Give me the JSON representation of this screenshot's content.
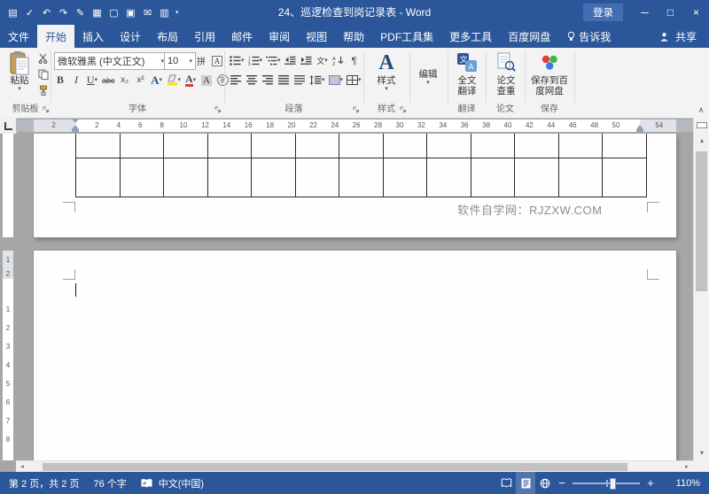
{
  "window": {
    "title": "24、巡逻检查到岗记录表 - Word",
    "login": "登录",
    "qat_icons": [
      "save",
      "spelling",
      "undo",
      "redo",
      "draw-table",
      "table",
      "new",
      "open",
      "email",
      "print"
    ],
    "controls": [
      "minimize",
      "maximize",
      "close"
    ]
  },
  "tabs": {
    "file": "文件",
    "active": "开始",
    "others": [
      "插入",
      "设计",
      "布局",
      "引用",
      "邮件",
      "审阅",
      "视图",
      "帮助",
      "PDF工具集",
      "更多工具",
      "百度网盘"
    ],
    "tell_me": "告诉我",
    "share": "共享"
  },
  "ribbon": {
    "clipboard": {
      "paste": "粘贴",
      "icons": [
        "cut",
        "copy",
        "format-painter"
      ],
      "label": "剪贴板"
    },
    "font": {
      "name": "微软雅黑 (中文正文)",
      "size": "10",
      "row1_icons": [
        "phonetic-guide",
        "character-border"
      ],
      "row2_icons": [
        "bold",
        "italic",
        "underline",
        "strikethrough",
        "subscript",
        "superscript",
        "text-effects",
        "highlight-color",
        "font-color",
        "character-shading",
        "enclose-character"
      ],
      "label": "字体"
    },
    "paragraph": {
      "row1_icons": [
        "bullets",
        "numbering",
        "multilevel-list",
        "decrease-indent",
        "increase-indent",
        "asian-layout",
        "sort",
        "show-marks"
      ],
      "row2_icons": [
        "align-left",
        "align-center",
        "align-right",
        "justify",
        "distribute",
        "line-spacing",
        "shading",
        "borders"
      ],
      "label": "段落"
    },
    "styles": {
      "button": "样式",
      "label": "样式"
    },
    "editing": {
      "button": "编辑"
    },
    "translate": {
      "button": "全文翻译",
      "label": "翻译"
    },
    "paper": {
      "button": "论文查重",
      "label": "论文"
    },
    "baidu": {
      "button": "保存到百度网盘",
      "label": "保存"
    }
  },
  "ruler": {
    "margin_left_number": "2",
    "unit_numbers": [
      "2",
      "4",
      "6",
      "8",
      "10",
      "12",
      "14",
      "16",
      "18",
      "20",
      "22",
      "24",
      "26",
      "28",
      "30",
      "32",
      "34",
      "36",
      "38",
      "40",
      "42",
      "44",
      "46",
      "48",
      "50"
    ],
    "right_margin_number": "54"
  },
  "vruler": {
    "margin_numbers": [
      "1",
      "2"
    ],
    "unit_numbers": [
      "1",
      "2",
      "3",
      "4",
      "5",
      "6",
      "7",
      "8"
    ]
  },
  "document": {
    "watermark": "软件自学网：RJZXW.COM",
    "table_columns": 13
  },
  "status": {
    "page_info": "第 2 页，共 2 页",
    "word_count": "76 个字",
    "language": "中文(中国)",
    "zoom": "110%"
  }
}
